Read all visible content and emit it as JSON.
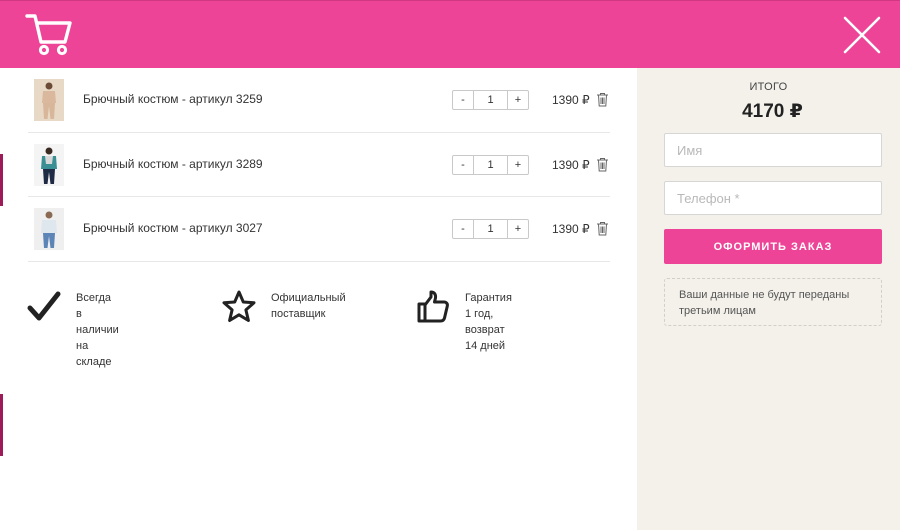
{
  "header": {
    "cart_icon": "shopping-cart-icon",
    "close_icon": "close-icon",
    "background": "#ee4497"
  },
  "cart": {
    "items": [
      {
        "title": "Брючный костюм - артикул 3259",
        "quantity": "1",
        "price": "1390 ₽",
        "minus_label": "-",
        "plus_label": "+"
      },
      {
        "title": "Брючный костюм - артикул 3289",
        "quantity": "1",
        "price": "1390 ₽",
        "minus_label": "-",
        "plus_label": "+"
      },
      {
        "title": "Брючный костюм - артикул 3027",
        "quantity": "1",
        "price": "1390 ₽",
        "minus_label": "-",
        "plus_label": "+"
      }
    ]
  },
  "features": [
    {
      "icon": "checkmark-icon",
      "text_line1": "Всегда в наличии на",
      "text_line2": "складе"
    },
    {
      "icon": "star-icon",
      "text_line1": "Официальный",
      "text_line2": "поставщик"
    },
    {
      "icon": "thumbs-up-icon",
      "text_line1": "Гарантия 1 год, возврат",
      "text_line2": "14 дней"
    }
  ],
  "order": {
    "total_label": "ИТОГО",
    "total_value": "4170 ₽",
    "name_placeholder": "Имя",
    "phone_placeholder": "Телефон *",
    "submit_label": "ОФОРМИТЬ ЗАКАЗ",
    "privacy_line1": "Ваши данные не будут переданы",
    "privacy_line2": "третьим лицам"
  },
  "colors": {
    "accent": "#ee4497",
    "sidebar_bg": "#f4f1ea"
  }
}
